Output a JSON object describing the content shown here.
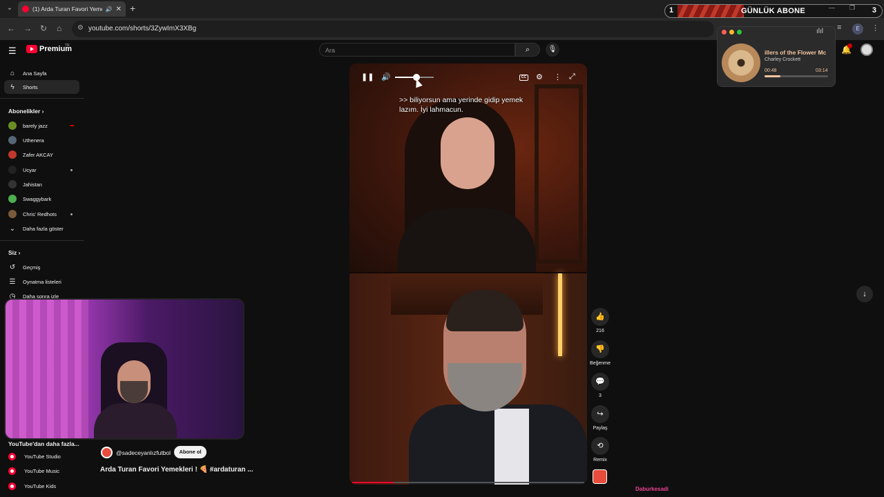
{
  "browser": {
    "tab_title": "(1) Arda Turan Favori Yemek",
    "url": "youtube.com/shorts/3ZywImX3XBg"
  },
  "overlay": {
    "sub_goal_left": "1",
    "sub_goal_label": "GÜNLÜK ABONE",
    "sub_goal_right": "3",
    "music": {
      "song": "illers of the Flower Mc",
      "artist": "Charley Crockett",
      "current": "00:48",
      "total": "03:14",
      "progress": 0.25
    },
    "streamer_handle": "Daburkesadi"
  },
  "header": {
    "logo_text": "Premium",
    "logo_region": "TR",
    "search_placeholder": "Ara"
  },
  "sidebar": {
    "main": [
      {
        "label": "Ana Sayfa",
        "icon": "home-icon"
      },
      {
        "label": "Shorts",
        "icon": "shorts-icon",
        "active": true
      }
    ],
    "subscriptions_title": "Abonelikler",
    "subscriptions": [
      {
        "label": "barely jazz",
        "color": "#6b8e23"
      },
      {
        "label": "Uthenera",
        "color": "#556677"
      },
      {
        "label": "Zafer AKCAY",
        "color": "#c0392b"
      },
      {
        "label": "Ucyar",
        "color": "#222222"
      },
      {
        "label": "Jahistan",
        "color": "#333333"
      },
      {
        "label": "Swaggybark",
        "color": "#4caf50"
      },
      {
        "label": "Chris' Redhots",
        "color": "#7a5a3a"
      }
    ],
    "show_more": "Daha fazla göster",
    "you_title": "Siz",
    "you_items": [
      {
        "label": "Geçmiş",
        "icon": "history-icon"
      },
      {
        "label": "Oynatma listeleri",
        "icon": "playlist-icon"
      },
      {
        "label": "Daha sonra izle",
        "icon": "clock-icon"
      }
    ],
    "more_from_title": "YouTube'dan daha fazla...",
    "more_from": [
      "YouTube Studio",
      "YouTube Music",
      "YouTube Kids"
    ]
  },
  "video": {
    "channel": "@sadeceyanlızfutbol",
    "subscribe": "Abone ol",
    "title": "Arda Turan Favori Yemekleri ! 🍕 #ardaturan ...",
    "subtitle": ">> biliyorsun ama yerinde gidip yemek\nlazım. İyi lahmacun.",
    "volume": 0.55,
    "progress": 0.18
  },
  "actions": {
    "likes": "216",
    "dislike": "Beğenme",
    "comments": "3",
    "share": "Paylaş",
    "remix": "Remix"
  }
}
